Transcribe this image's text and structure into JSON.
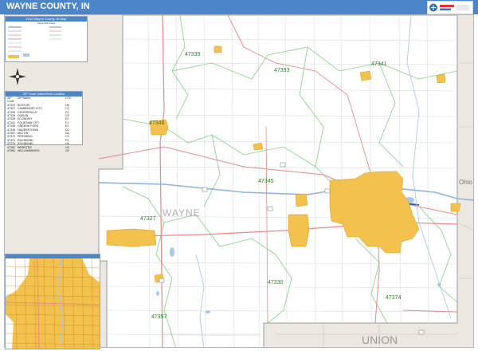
{
  "header": {
    "title": "WAYNE COUNTY, IN"
  },
  "legend": {
    "title": "2016 Wayne County, IN Map",
    "subtitle": "Cities and Towns"
  },
  "zip_index": {
    "title": "ZIP Code Index/Grid Location",
    "columns": [
      "ZIP Code",
      "ZIP Name",
      "LOC"
    ],
    "rows": [
      [
        "47324",
        "BOSTON",
        "H6"
      ],
      [
        "47327",
        "CAMBRIDGE CITY",
        "C3"
      ],
      [
        "47330",
        "CENTERVILLE",
        "F4"
      ],
      [
        "47335",
        "DUBLIN",
        "C5"
      ],
      [
        "47339",
        "ECONOMY",
        "E2"
      ],
      [
        "47341",
        "FOUNTAIN CITY",
        "F1"
      ],
      [
        "47345",
        "GREENS FORK",
        "E2"
      ],
      [
        "47346",
        "HAGERSTOWN",
        "D2"
      ],
      [
        "47357",
        "MILTON",
        "D6"
      ],
      [
        "47370",
        "PERSHING",
        "C3"
      ],
      [
        "47374",
        "RICHMOND",
        "F5"
      ],
      [
        "47375",
        "RICHMOND",
        "H4"
      ],
      [
        "47392",
        "WEBSTER",
        "H3"
      ],
      [
        "47393",
        "WILLIAMSBURG",
        "G2"
      ]
    ]
  },
  "map": {
    "county_label": "WAYNE",
    "neighbors": {
      "east": "Ohio",
      "south": "UNION"
    },
    "zip_labels": [
      "47339",
      "47393",
      "47341",
      "47346",
      "47345",
      "47327",
      "47330",
      "47357",
      "47374"
    ],
    "colors": {
      "water": "#a9c9ea",
      "city": "#f2c14e",
      "zip_boundary": "#5bc85b",
      "highway": "#e58a8a",
      "outside": "#ece7e0"
    }
  }
}
